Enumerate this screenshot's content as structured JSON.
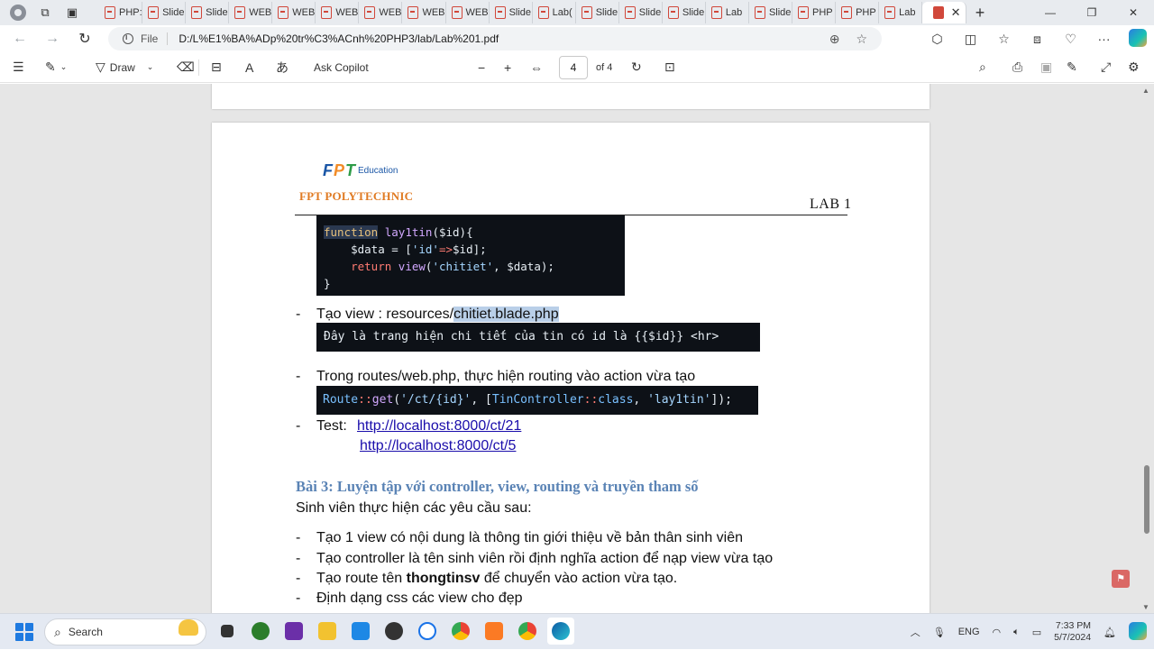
{
  "browser": {
    "tabs": [
      {
        "label": "PHP:"
      },
      {
        "label": "Slide"
      },
      {
        "label": "Slide"
      },
      {
        "label": "WEB"
      },
      {
        "label": "WEB"
      },
      {
        "label": "WEB"
      },
      {
        "label": "WEB"
      },
      {
        "label": "WEB"
      },
      {
        "label": "WEB"
      },
      {
        "label": "Slide"
      },
      {
        "label": "Lab("
      },
      {
        "label": "Slide"
      },
      {
        "label": "Slide"
      },
      {
        "label": "Slide"
      },
      {
        "label": "Lab"
      },
      {
        "label": "Slide"
      },
      {
        "label": "PHP"
      },
      {
        "label": "PHP"
      },
      {
        "label": "Lab"
      }
    ],
    "active_tab_close": "✕",
    "new_tab": "+",
    "address": {
      "protocol": "File",
      "url": "D:/L%E1%BA%ADp%20tr%C3%ACnh%20PHP3/lab/Lab%201.pdf"
    }
  },
  "pdf_toolbar": {
    "draw_label": "Draw",
    "ask_copilot_label": "Ask Copilot",
    "page_current": "4",
    "page_total": "of 4"
  },
  "document": {
    "logo_letters": [
      "F",
      "P",
      "T"
    ],
    "logo_colors": [
      "#1a56a6",
      "#f28c28",
      "#2e9c48"
    ],
    "logo_edu": "Education",
    "logo_poly": "FPT POLYTECHNIC",
    "header_right": "LAB 1",
    "code1_lines": [
      "function lay1tin($id){",
      "    $data = ['id'=>$id];",
      "    return view('chitiet', $data);",
      "}"
    ],
    "bullet1_prefix": "Tạo view : resources/",
    "bullet1_highlight": "chitiet.blade.php",
    "code2": "Đây là trang hiện chi tiết của tin có id là {{$id}} <hr>",
    "bullet2": "Trong routes/web.php, thực hiện routing vào action vừa tạo",
    "code3": "Route::get('/ct/{id}', [TinController::class, 'lay1tin']);",
    "test_label": "Test:",
    "link1": "http://localhost:8000/ct/21",
    "link2": "http://localhost:8000/ct/5",
    "heading": "Bài 3: Luyện tập với controller, view, routing và truyền tham số",
    "intro": "Sinh viên thực hiện các yêu cầu sau:",
    "req1": "Tạo 1 view có nội dung là thông tin giới thiệu về bản thân sinh viên",
    "req2": "Tạo controller là tên sinh viên rồi định nghĩa action để nạp view vừa tạo",
    "req3_prefix": "Tạo route tên ",
    "req3_bold": "thongtinsv",
    "req3_suffix": " để chuyển vào action vừa tạo.",
    "req4": "Định dạng css các view cho đẹp",
    "dash": "-"
  },
  "taskbar": {
    "search_placeholder": "Search",
    "language": "ENG",
    "time": "7:33 PM",
    "date": "5/7/2024"
  }
}
